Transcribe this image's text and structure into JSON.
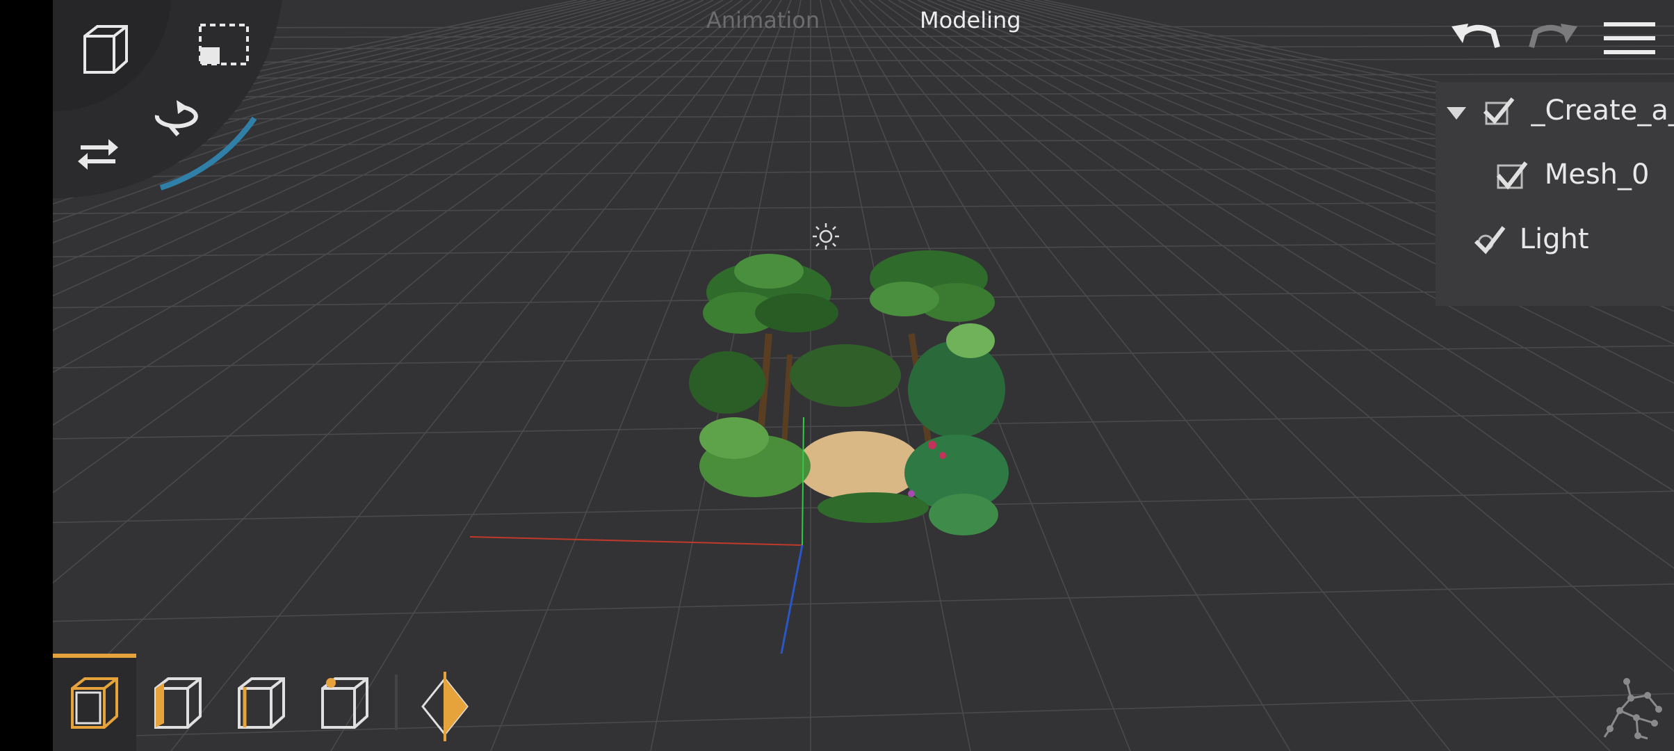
{
  "header": {
    "tabs": [
      {
        "label": "Animation",
        "active": false
      },
      {
        "label": "Modeling",
        "active": true
      }
    ]
  },
  "toolbar_right": {
    "icons": [
      "undo-icon",
      "redo-icon",
      "menu-icon"
    ]
  },
  "gizmo": {
    "icons": [
      "cube-view-icon",
      "selection-rect-icon",
      "rotate-icon",
      "swap-icon"
    ]
  },
  "outliner": {
    "items": [
      {
        "label": "_Create_a_s",
        "checked": true,
        "expanded": true,
        "icon": "object-icon"
      },
      {
        "label": "Mesh_0",
        "checked": true,
        "icon": "mesh-icon"
      },
      {
        "label": "Light",
        "checked": true,
        "icon": "light-icon"
      }
    ]
  },
  "bottom_toolbar": {
    "modes": [
      "object-mode-icon",
      "face-mode-icon",
      "edge-mode-icon",
      "vertex-mode-icon",
      "keyframe-icon"
    ],
    "active_mode": "object-mode-icon"
  },
  "colors": {
    "accent": "#e7a33b",
    "background": "#333335",
    "grid": "#4a4a4c",
    "axis_x": "#c0392b",
    "axis_y": "#2ecc40",
    "axis_z": "#2a56c6",
    "orbit_ring": "#2f7fa8"
  }
}
